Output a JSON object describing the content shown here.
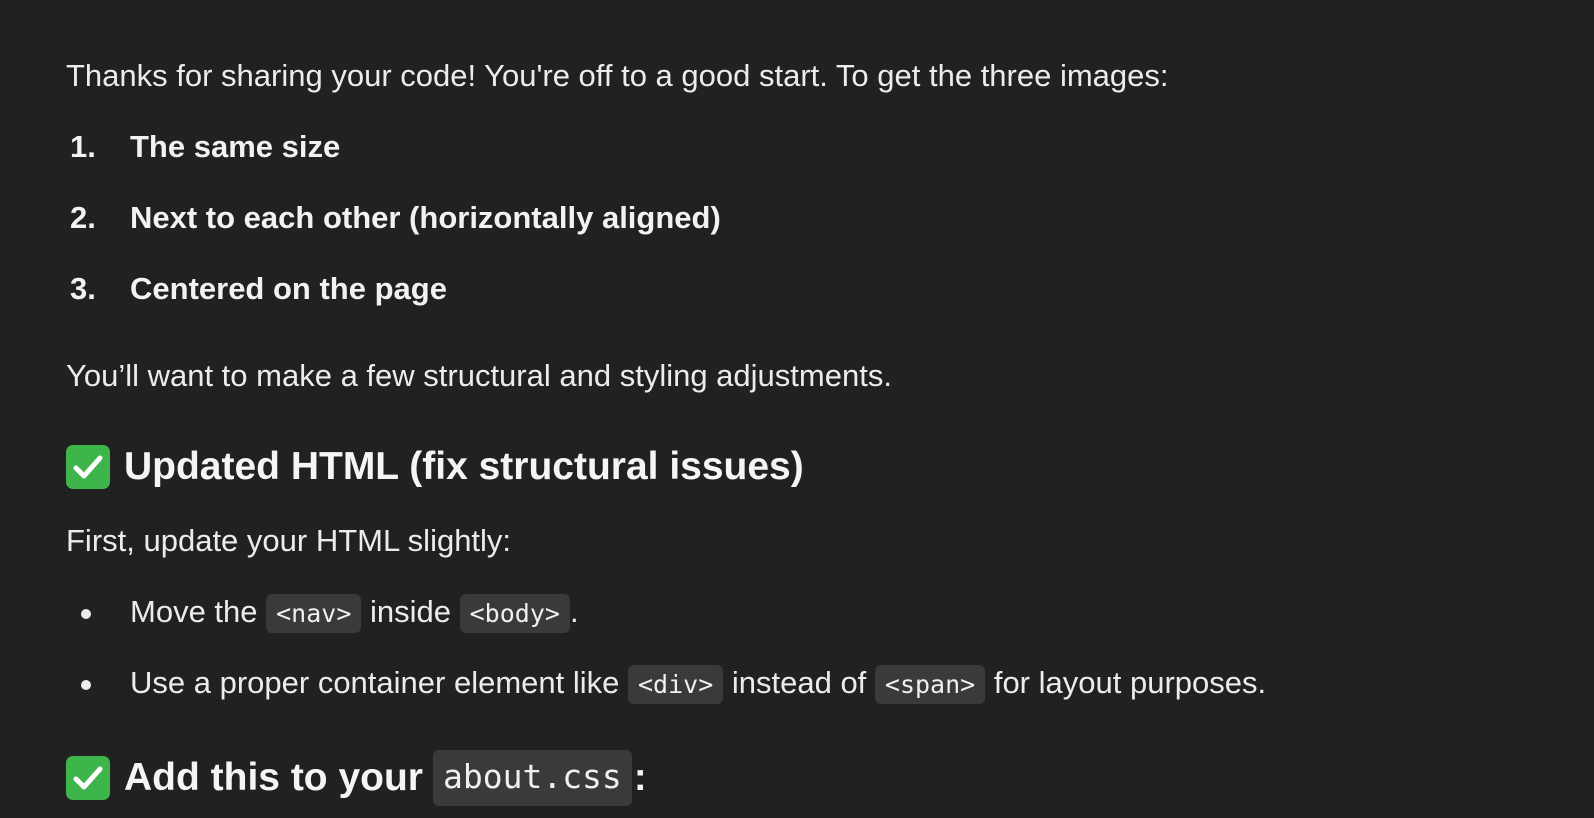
{
  "intro": "Thanks for sharing your code! You're off to a good start. To get the three images:",
  "goals": [
    {
      "num": "1.",
      "text": "The same size"
    },
    {
      "num": "2.",
      "text": "Next to each other (horizontally aligned)"
    },
    {
      "num": "3.",
      "text": "Centered on the page"
    }
  ],
  "adjustments": "You’ll want to make a few structural and styling adjustments.",
  "section1": {
    "title": "Updated HTML (fix structural issues)",
    "lead": "First, update your HTML slightly:",
    "bullets": [
      {
        "a": "Move the ",
        "code1": "<nav>",
        "b": " inside ",
        "code2": "<body>",
        "c": "."
      },
      {
        "a": "Use a proper container element like ",
        "code1": "<div>",
        "b": " instead of ",
        "code2": "<span>",
        "c": " for layout purposes."
      }
    ]
  },
  "section2": {
    "title_prefix": "Add this to your ",
    "title_code": "about.css",
    "title_suffix": ":"
  },
  "icons": {
    "heading_icon": "check-mark-button-icon",
    "check_color": "#3eb54a"
  },
  "colors": {
    "background": "#212121",
    "text": "#ececec",
    "code_background": "#3a3a3a"
  }
}
